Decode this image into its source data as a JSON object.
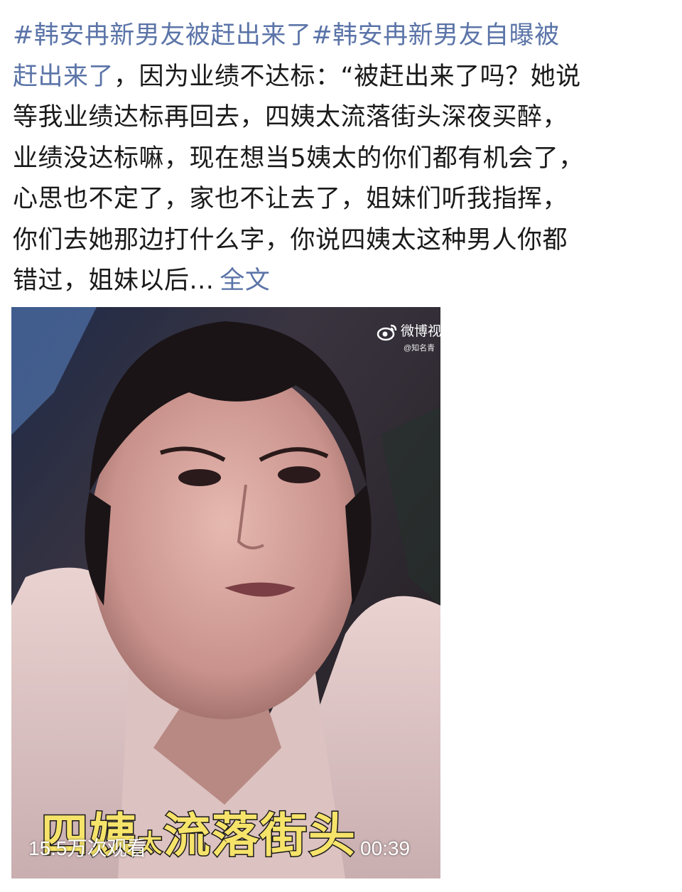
{
  "post": {
    "hashtag_1": "#韩安冉新男友被赶出来了",
    "hashtag_2": "#韩安冉新男友自曝被赶出来了",
    "body_lines": [
      "，因为业绩不达标：“被赶出来了吗？她说",
      "等我业绩达标再回去，四姨太流落街头深夜买醉，",
      "业绩没达标嘛，现在想当5姨太的你们都有机会了，",
      "心思也不定了，家也不让去了，姐妹们听我指挥，",
      "你们去她那边打什么字，你说四姨太这种男人你都",
      "错过，姐妹以后..."
    ],
    "hashtag_2_first_part": "#韩安冉新男友自曝被",
    "hashtag_2_second_part": "赶出来了",
    "full_text_label": "全文"
  },
  "video": {
    "watermark_brand": "微博视",
    "watermark_handle": "@知名青",
    "watermark_icon": "weibo-logo-icon",
    "caption_part_1": "四姨",
    "caption_small": "太",
    "caption_part_2": "流落街头",
    "view_count": "15.5万次观看",
    "duration": "00:39"
  },
  "colors": {
    "hashtag": "#5b74a8",
    "text": "#1a1a1a",
    "caption_fill": "#f6e36a",
    "background": "#ffffff"
  }
}
